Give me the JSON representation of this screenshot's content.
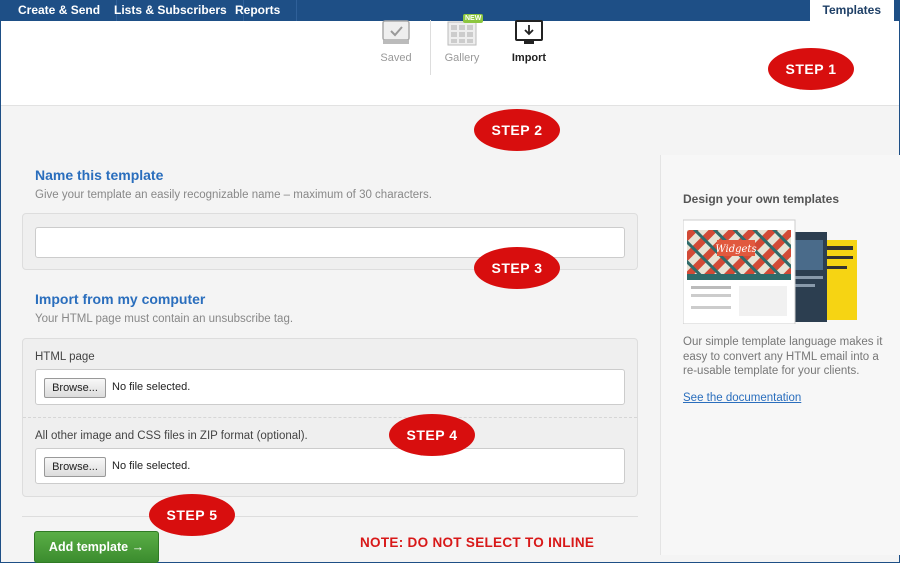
{
  "topnav": {
    "items": [
      "Create & Send",
      "Lists & Subscribers",
      "Reports"
    ],
    "active_tab": "Templates"
  },
  "subheader": {
    "buttons": [
      {
        "label": "Saved",
        "icon": "monitor-check-icon"
      },
      {
        "label": "Gallery",
        "icon": "grid-icon",
        "badge": "NEW"
      },
      {
        "label": "Import",
        "icon": "monitor-download-icon"
      }
    ]
  },
  "name_section": {
    "title": "Name this template",
    "description": "Give your template an easily recognizable name – maximum of 30 characters.",
    "input_value": ""
  },
  "import_section": {
    "title": "Import from my computer",
    "description": "Your HTML page must contain an unsubscribe tag.",
    "html_label": "HTML page",
    "zip_label": "All other image and CSS files in ZIP format (optional).",
    "browse_label": "Browse...",
    "file_status": "No file selected."
  },
  "actions": {
    "add_template": "Add template →"
  },
  "sidebar": {
    "title": "Design your own templates",
    "preview_heading": "Widgets",
    "text": "Our simple template language makes it easy to convert any HTML email into a re-usable template for your clients.",
    "link": "See the documentation"
  },
  "annotations": {
    "step1": "STEP 1",
    "step2": "STEP 2",
    "step3": "STEP 3",
    "step4": "STEP 4",
    "step5": "STEP 5",
    "note": "NOTE: DO NOT SELECT TO INLINE"
  },
  "colors": {
    "nav": "#1e4f86",
    "heading_blue": "#2a6ebd",
    "button_green": "#4a9e3a",
    "step_red": "#d80e0e"
  }
}
